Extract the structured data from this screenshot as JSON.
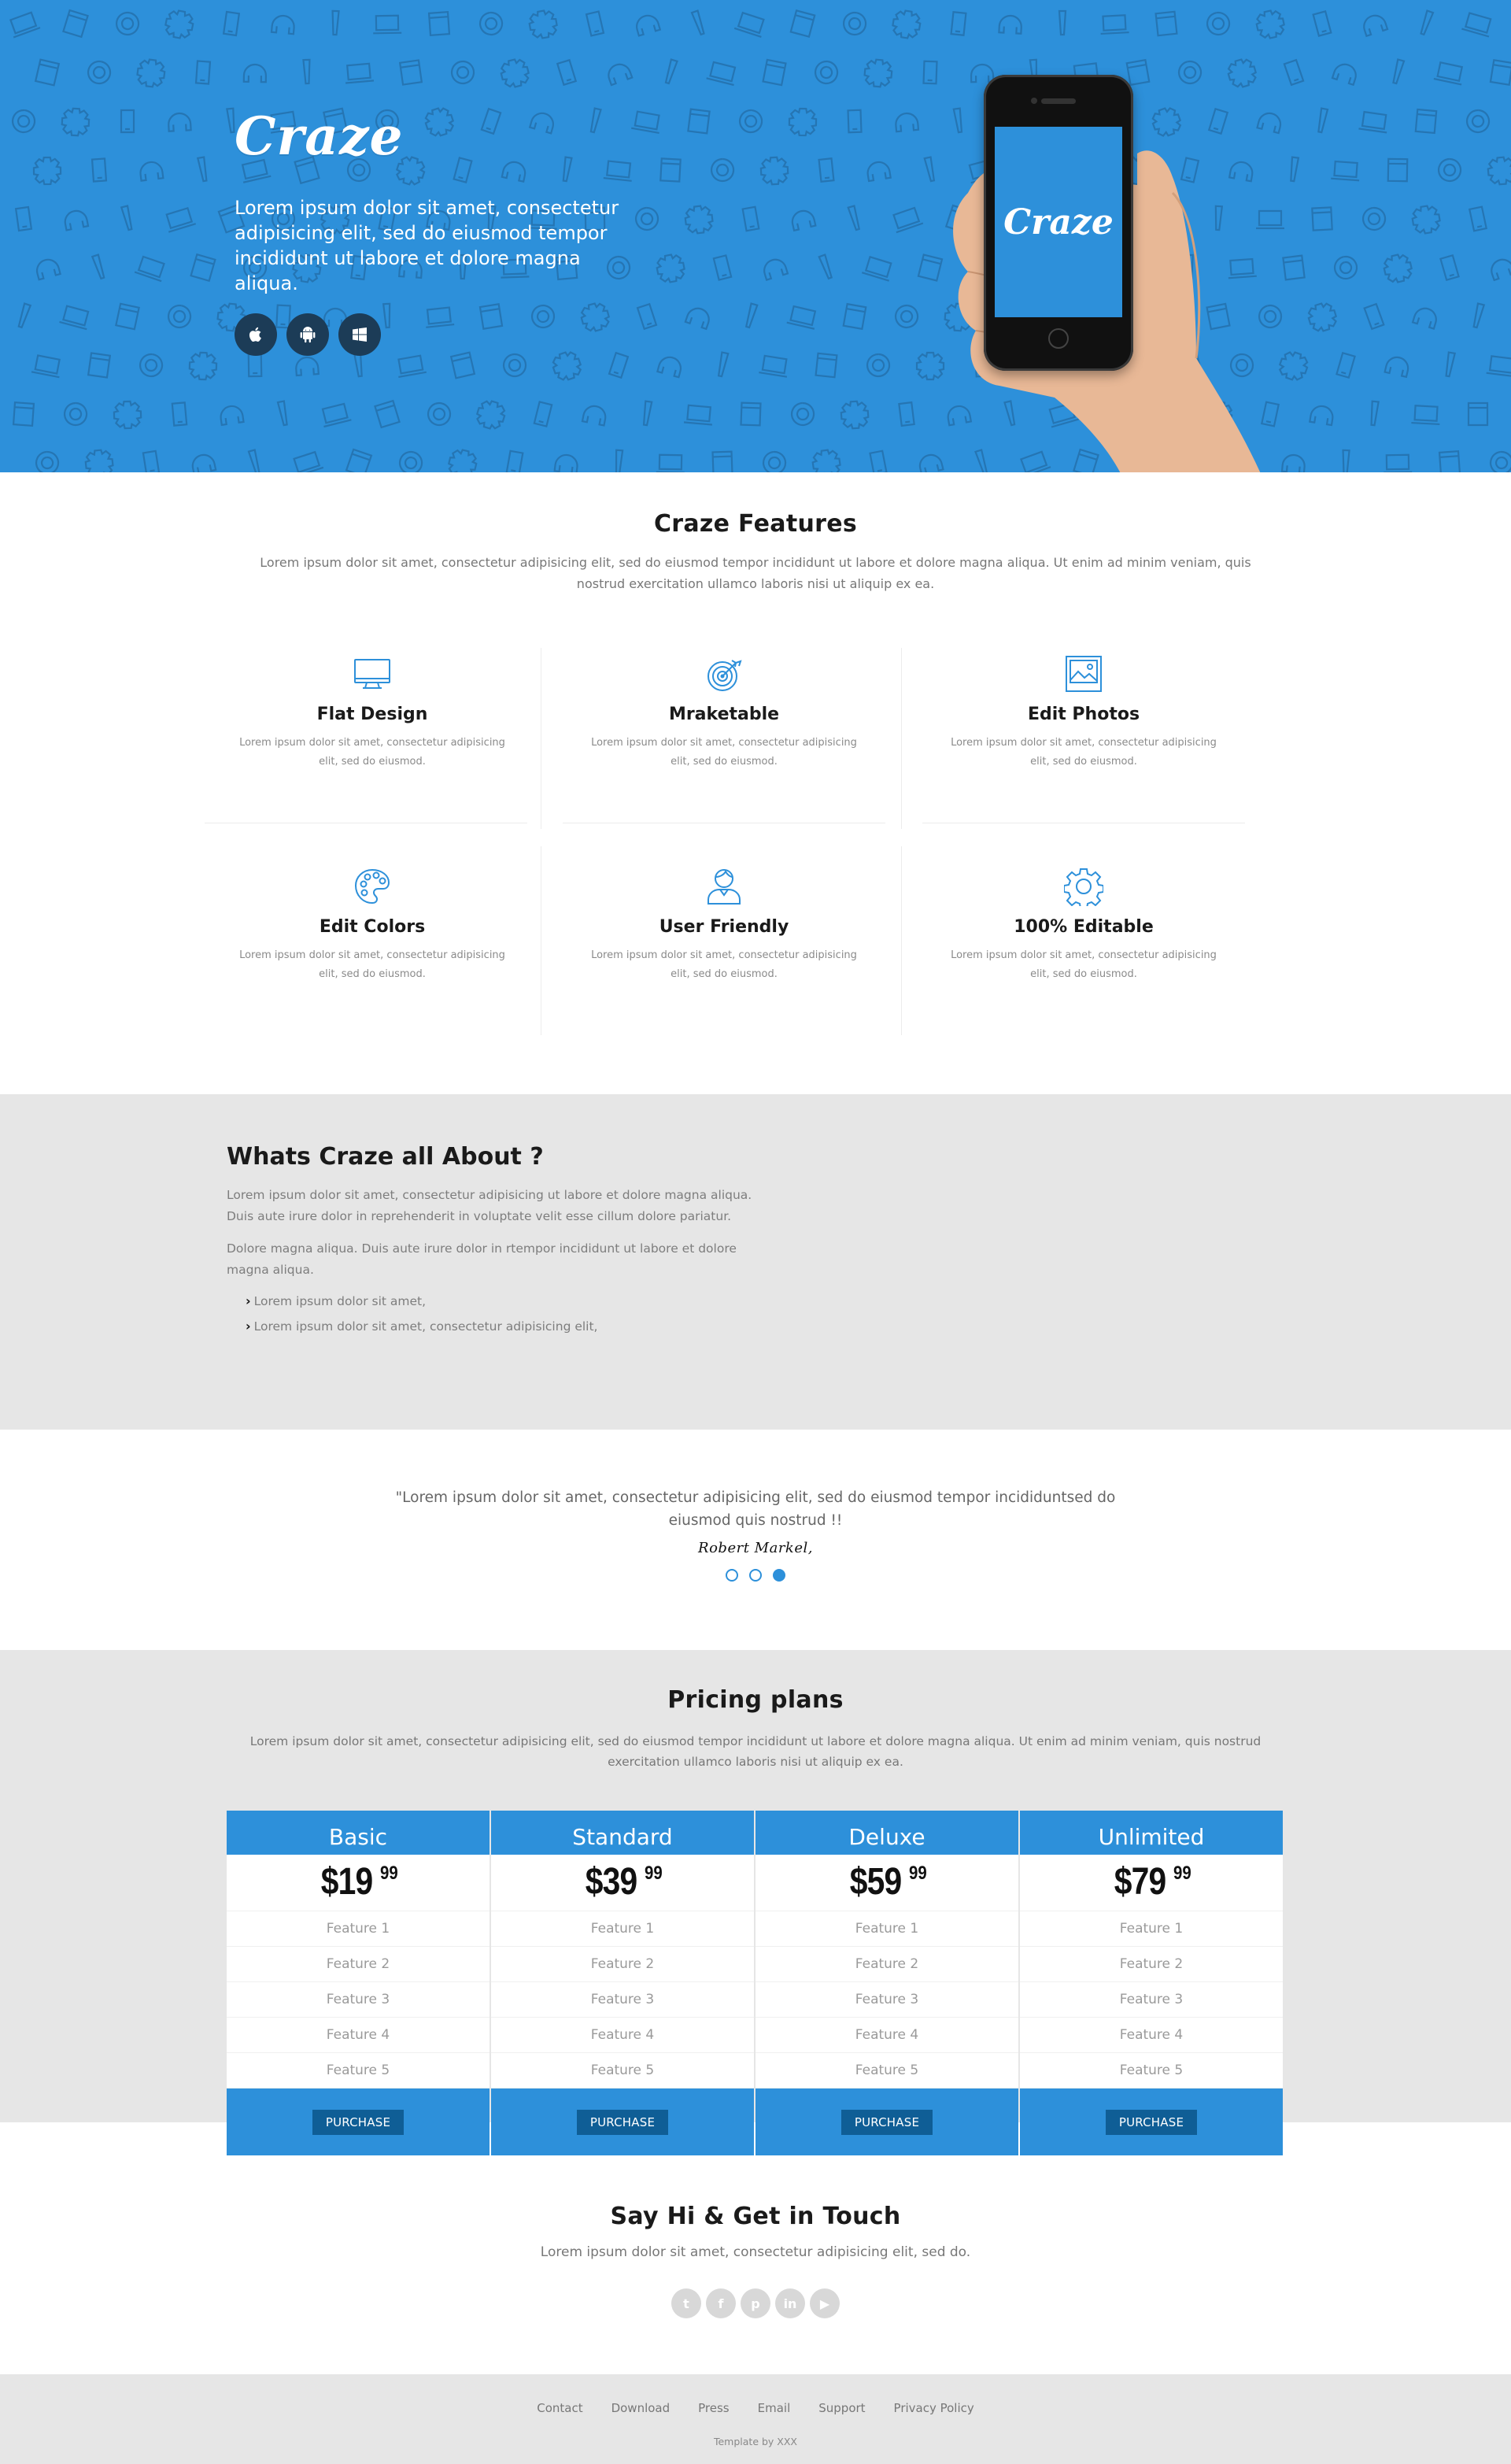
{
  "hero": {
    "logo": "Craze",
    "text": "Lorem ipsum dolor sit amet, consectetur adipisicing elit, sed do eiusmod tempor incididunt ut labore et dolore magna aliqua.",
    "phone_logo": "Craze",
    "store_icons": [
      "apple-icon",
      "android-icon",
      "windows-icon"
    ]
  },
  "features": {
    "title": "Craze Features",
    "subtitle": "Lorem ipsum dolor sit amet, consectetur adipisicing elit, sed do eiusmod tempor incididunt ut labore et dolore magna aliqua. Ut enim ad minim veniam, quis nostrud exercitation ullamco laboris nisi ut aliquip ex ea.",
    "items": [
      {
        "icon": "monitor-icon",
        "title": "Flat Design",
        "desc": "Lorem ipsum dolor sit amet, consectetur adipisicing elit, sed do eiusmod."
      },
      {
        "icon": "target-icon",
        "title": "Mraketable",
        "desc": "Lorem ipsum dolor sit amet, consectetur adipisicing elit, sed do eiusmod."
      },
      {
        "icon": "photo-icon",
        "title": "Edit Photos",
        "desc": "Lorem ipsum dolor sit amet, consectetur adipisicing elit, sed do eiusmod."
      },
      {
        "icon": "palette-icon",
        "title": "Edit Colors",
        "desc": "Lorem ipsum dolor sit amet, consectetur adipisicing elit, sed do eiusmod."
      },
      {
        "icon": "user-icon",
        "title": "User Friendly",
        "desc": "Lorem ipsum dolor sit amet, consectetur adipisicing elit, sed do eiusmod."
      },
      {
        "icon": "gear-icon",
        "title": "100% Editable",
        "desc": "Lorem ipsum dolor sit amet, consectetur adipisicing elit, sed do eiusmod."
      }
    ]
  },
  "about": {
    "title": "Whats Craze all About ?",
    "p1": "Lorem ipsum dolor sit amet, consectetur adipisicing ut labore et dolore magna aliqua. Duis aute irure dolor in reprehenderit in voluptate velit esse cillum dolore pariatur.",
    "p2": "Dolore magna aliqua. Duis aute irure dolor in rtempor incididunt ut labore et dolore magna aliqua.",
    "list": [
      "Lorem ipsum dolor sit amet,",
      "Lorem ipsum dolor sit amet, consectetur adipisicing elit,"
    ]
  },
  "testimonial": {
    "quote": "\"Lorem ipsum dolor sit amet, consectetur adipisicing elit, sed do eiusmod tempor incididuntsed do eiusmod quis nostrud !!",
    "author": "Robert Markel,",
    "active_slide": 3,
    "slide_count": 3
  },
  "pricing": {
    "title": "Pricing plans",
    "subtitle": "Lorem ipsum dolor sit amet, consectetur adipisicing elit, sed do eiusmod tempor incididunt ut labore et dolore magna aliqua. Ut enim ad minim veniam, quis nostrud exercitation ullamco laboris nisi ut aliquip ex ea.",
    "plans": [
      {
        "name": "Basic",
        "price": "$19",
        "cents": "99",
        "features": [
          "Feature 1",
          "Feature 2",
          "Feature 3",
          "Feature 4",
          "Feature 5"
        ],
        "button": "PURCHASE"
      },
      {
        "name": "Standard",
        "price": "$39",
        "cents": "99",
        "features": [
          "Feature 1",
          "Feature 2",
          "Feature 3",
          "Feature 4",
          "Feature 5"
        ],
        "button": "PURCHASE"
      },
      {
        "name": "Deluxe",
        "price": "$59",
        "cents": "99",
        "features": [
          "Feature 1",
          "Feature 2",
          "Feature 3",
          "Feature 4",
          "Feature 5"
        ],
        "button": "PURCHASE"
      },
      {
        "name": "Unlimited",
        "price": "$79",
        "cents": "99",
        "features": [
          "Feature 1",
          "Feature 2",
          "Feature 3",
          "Feature 4",
          "Feature 5"
        ],
        "button": "PURCHASE"
      }
    ]
  },
  "contact": {
    "title": "Say Hi & Get in Touch",
    "subtitle": "Lorem ipsum dolor sit amet, consectetur adipisicing elit, sed do.",
    "social": [
      {
        "icon": "twitter-icon",
        "glyph": "t"
      },
      {
        "icon": "facebook-icon",
        "glyph": "f"
      },
      {
        "icon": "pinterest-icon",
        "glyph": "p"
      },
      {
        "icon": "linkedin-icon",
        "glyph": "in"
      },
      {
        "icon": "youtube-icon",
        "glyph": "▶"
      }
    ]
  },
  "footer": {
    "links": [
      "Contact",
      "Download",
      "Press",
      "Email",
      "Support",
      "Privacy Policy"
    ],
    "credit": "Template by XXX"
  },
  "colors": {
    "brand_blue": "#2d90da",
    "dark_button": "#0f5e96",
    "section_gray": "#e6e6e6"
  }
}
